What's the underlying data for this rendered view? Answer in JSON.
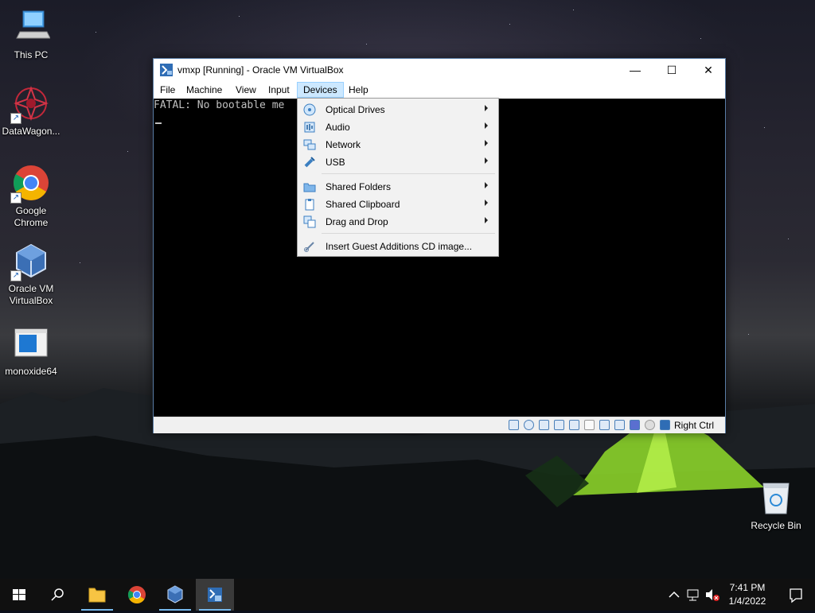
{
  "desktop": {
    "icons": [
      {
        "label": "This PC"
      },
      {
        "label": "DataWagon..."
      },
      {
        "label": "Google Chrome"
      },
      {
        "label": "Oracle VM VirtualBox"
      },
      {
        "label": "monoxide64"
      },
      {
        "label": "Recycle Bin"
      }
    ]
  },
  "window": {
    "title": "vmxp [Running] - Oracle VM VirtualBox",
    "controls": {
      "minimize": "—",
      "maximize": "☐",
      "close": "✕"
    },
    "menu": [
      "File",
      "Machine",
      "View",
      "Input",
      "Devices",
      "Help"
    ],
    "active_menu": "Devices",
    "screen_text": "FATAL: No bootable me",
    "status": {
      "host_key": "Right Ctrl"
    }
  },
  "devices_menu": {
    "items": [
      {
        "label": "Optical Drives",
        "icon": "optical-disc-icon",
        "submenu": true
      },
      {
        "label": "Audio",
        "icon": "audio-icon",
        "submenu": true
      },
      {
        "label": "Network",
        "icon": "network-icon",
        "submenu": true
      },
      {
        "label": "USB",
        "icon": "usb-icon",
        "submenu": true
      },
      {
        "label": "Shared Folders",
        "icon": "folder-icon",
        "submenu": true
      },
      {
        "label": "Shared Clipboard",
        "icon": "clipboard-icon",
        "submenu": true
      },
      {
        "label": "Drag and Drop",
        "icon": "drag-drop-icon",
        "submenu": true
      },
      {
        "label": "Insert Guest Additions CD image...",
        "icon": "guest-additions-icon",
        "submenu": false
      }
    ]
  },
  "taskbar": {
    "clock_time": "7:41 PM",
    "clock_date": "1/4/2022"
  },
  "colors": {
    "menu_highlight": "#cce8ff",
    "taskbar": "#101010",
    "accent": "#76b9ed"
  }
}
